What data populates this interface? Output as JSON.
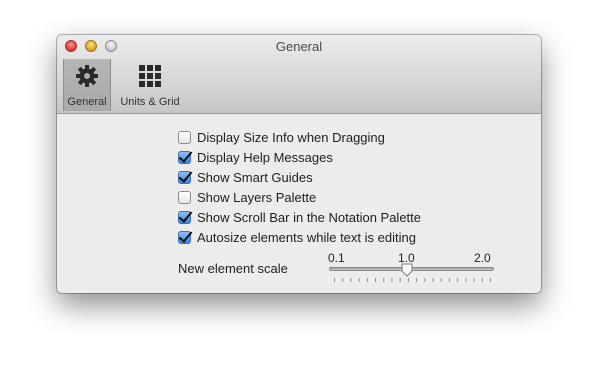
{
  "window": {
    "title": "General"
  },
  "toolbar": {
    "items": [
      {
        "label": "General",
        "icon": "gear-icon",
        "selected": true
      },
      {
        "label": "Units & Grid",
        "icon": "grid-icon",
        "selected": false
      }
    ]
  },
  "options": [
    {
      "label": "Display Size Info when Dragging",
      "checked": false
    },
    {
      "label": "Display Help Messages",
      "checked": true
    },
    {
      "label": "Show Smart Guides",
      "checked": true
    },
    {
      "label": "Show Layers Palette",
      "checked": false
    },
    {
      "label": "Show Scroll Bar in the Notation Palette",
      "checked": true
    },
    {
      "label": "Autosize elements while text is editing",
      "checked": true
    }
  ],
  "scale": {
    "label": "New element scale",
    "min_label": "0.1",
    "mid_label": "1.0",
    "max_label": "2.0",
    "min": 0.1,
    "max": 2.0,
    "value": 1.0,
    "tick_count": 20
  },
  "colors": {
    "checkbox_checked": "#3c83d8",
    "close_button": "#e0443a",
    "minimize_button": "#e6a62c",
    "zoom_button": "#cfcfcf"
  }
}
